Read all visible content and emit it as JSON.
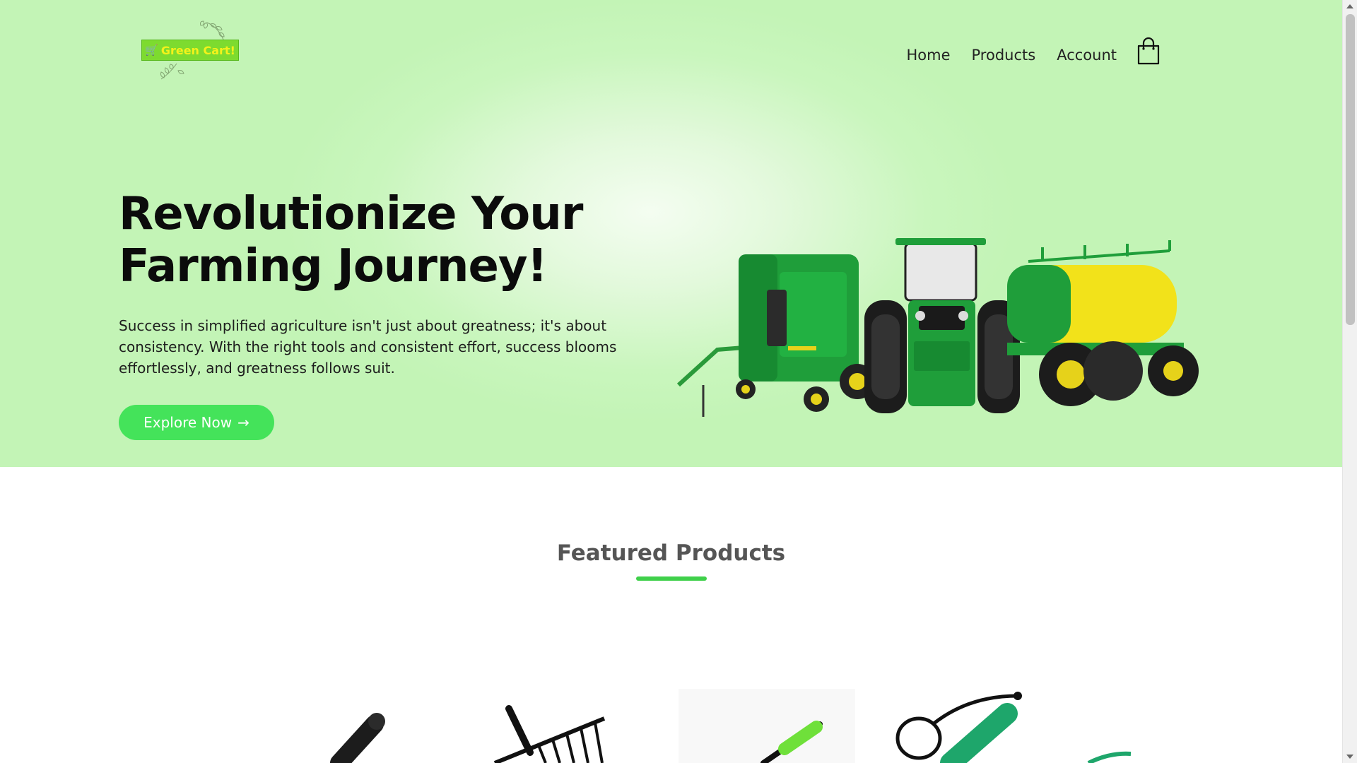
{
  "brand": {
    "logo_text": "Green Cart!",
    "accent": "#44e35a",
    "logo_bg": "#7ddb2f",
    "logo_text_color": "#f4f21a"
  },
  "nav": {
    "links": [
      "Home",
      "Products",
      "Account"
    ],
    "cart_icon": "shopping-bag-icon"
  },
  "hero": {
    "title_line1": "Revolutionize Your",
    "title_line2": "Farming Journey!",
    "description": "Success in simplified agriculture isn't just about greatness; it's about consistency. With the right tools and consistent effort, success blooms effortlessly, and greatness follows suit.",
    "cta_label": "Explore Now",
    "cta_arrow": "→",
    "image": "farm-machinery-image",
    "bg_color": "#c3f4b6"
  },
  "featured": {
    "title": "Featured Products",
    "products": [
      "hand-tool-grip-image",
      "rake-image",
      "green-handle-tool-image",
      "green-sprayer-image"
    ]
  }
}
